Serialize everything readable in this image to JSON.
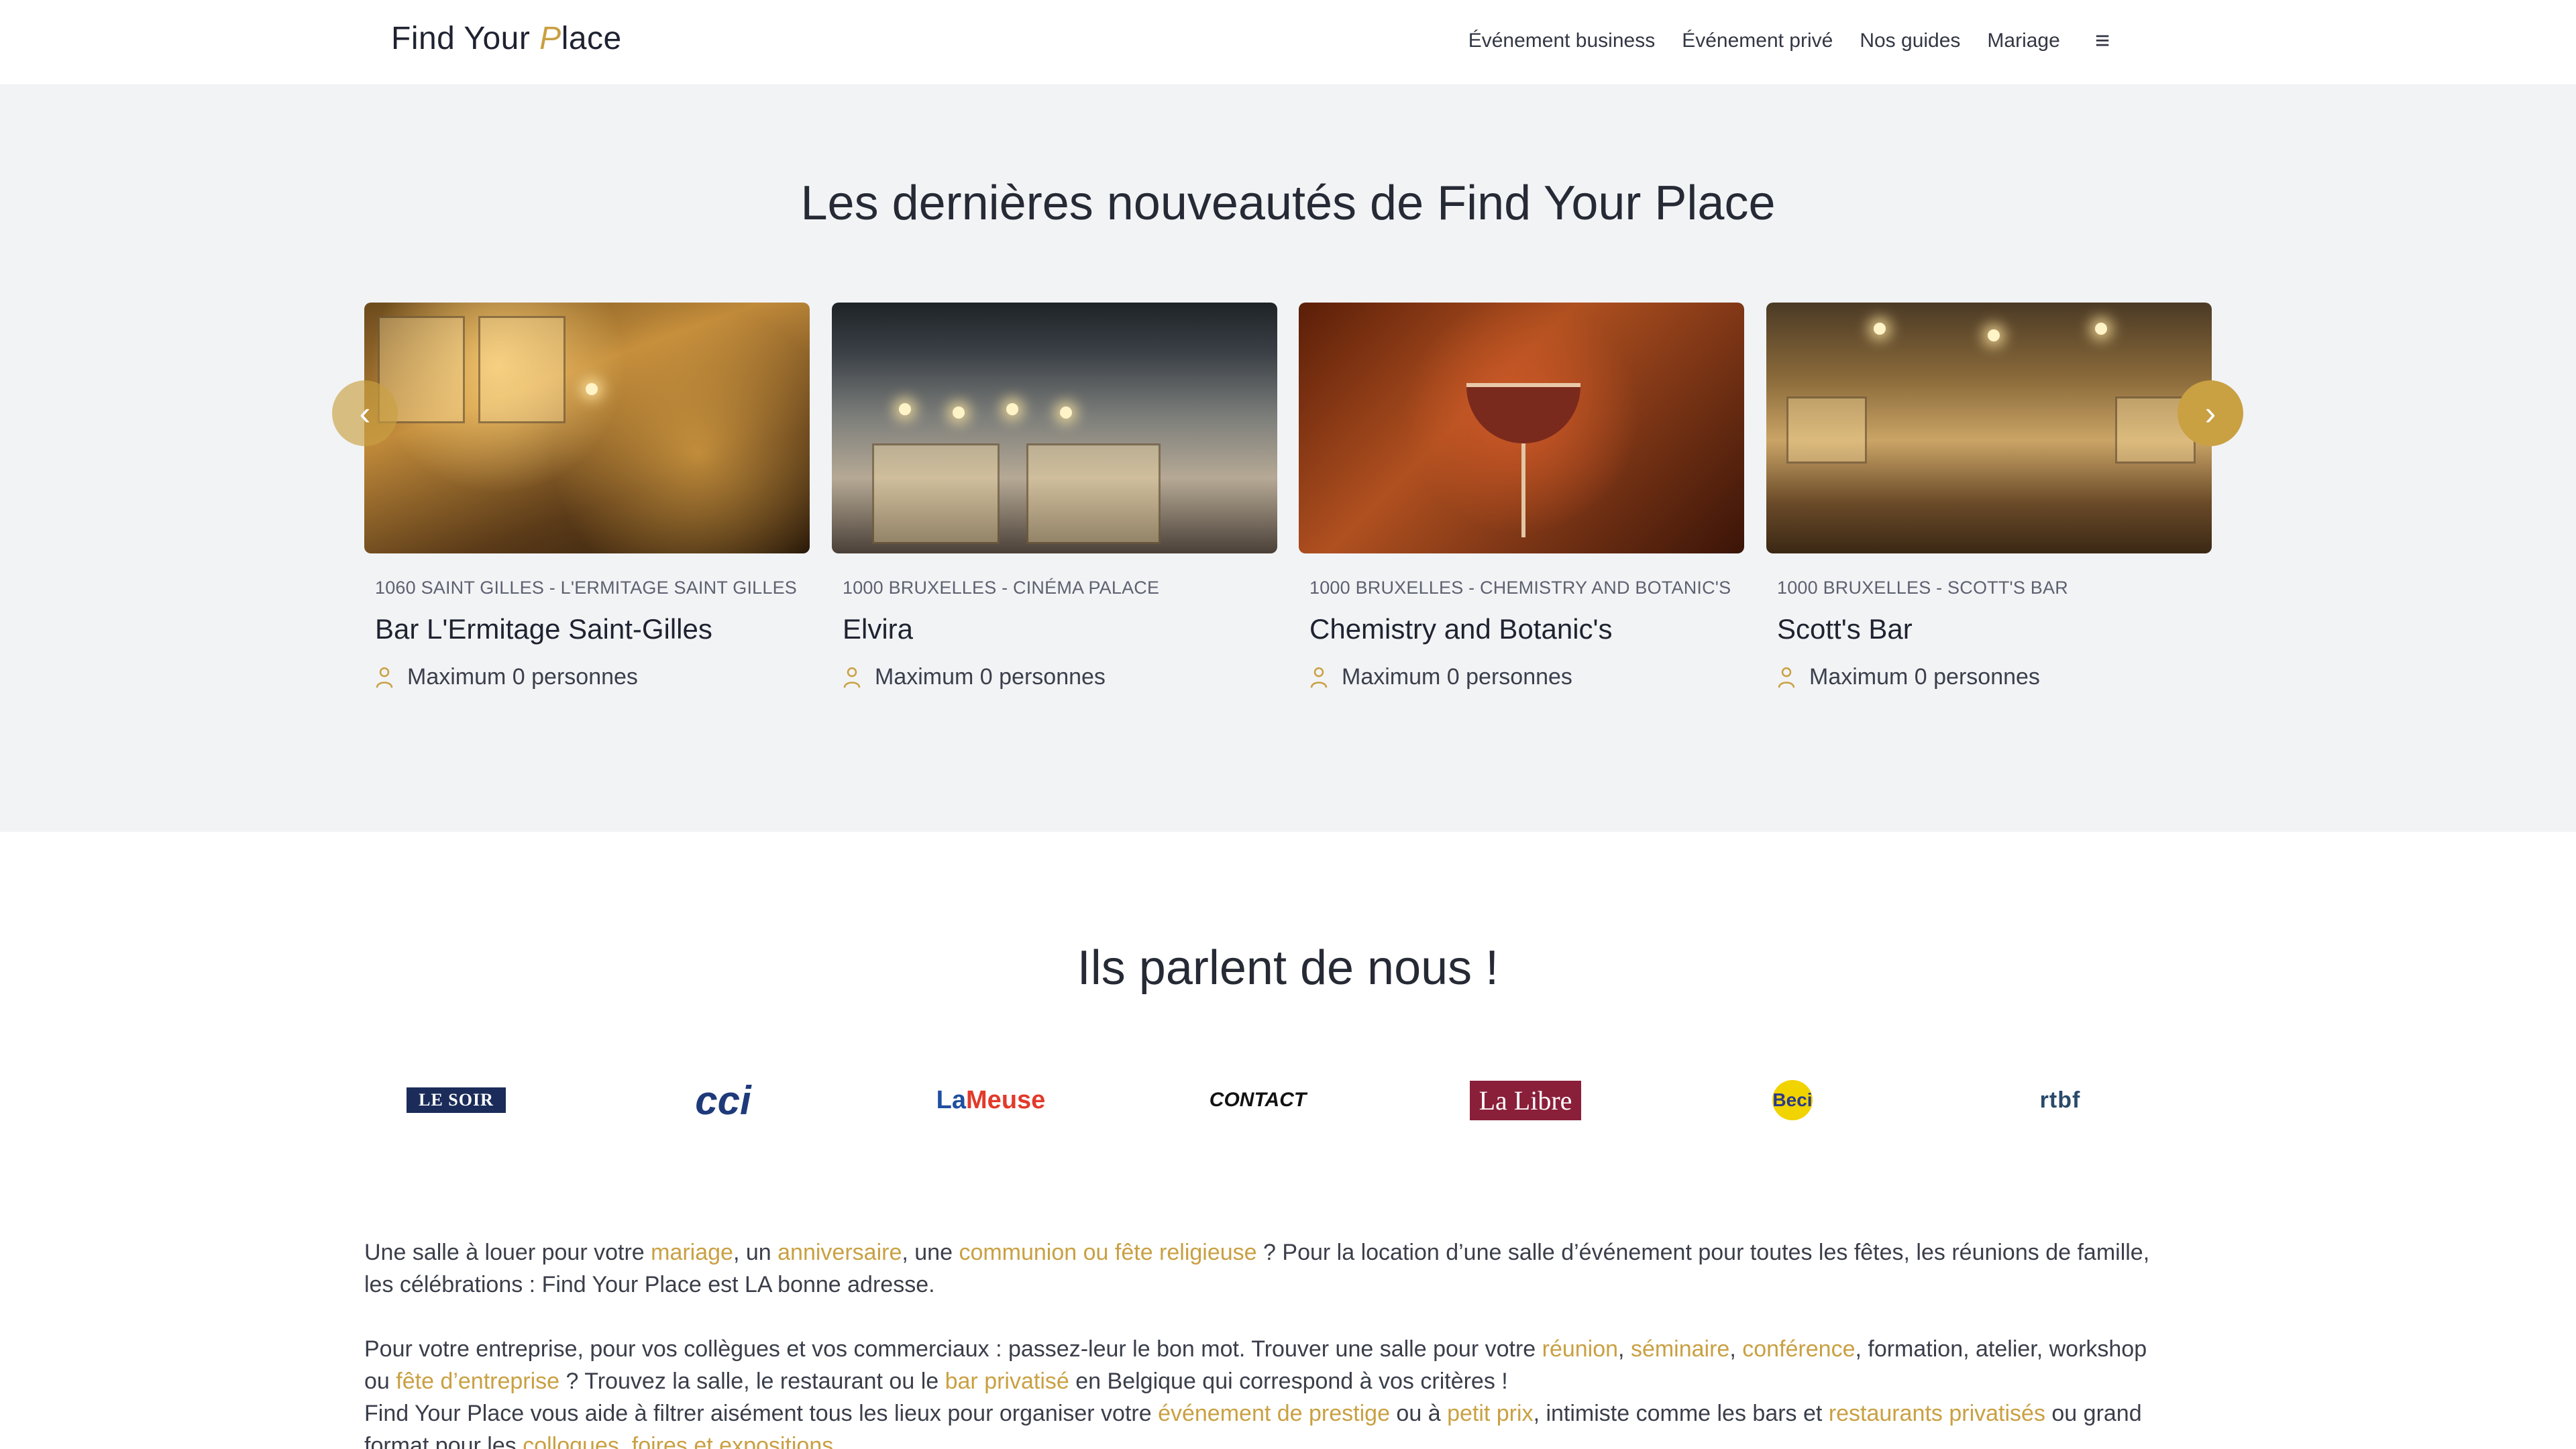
{
  "header": {
    "logo_text_a": "Find Your ",
    "logo_text_accent": "P",
    "logo_text_b": "lace",
    "nav": [
      {
        "label": "Événement business"
      },
      {
        "label": "Événement privé"
      },
      {
        "label": "Nos guides"
      },
      {
        "label": "Mariage"
      }
    ],
    "menu_icon": "≡"
  },
  "latest": {
    "title": "Les dernières nouveautés de Find Your Place",
    "prev_icon": "‹",
    "next_icon": "›",
    "cards": [
      {
        "location": "1060 SAINT GILLES - L'ERMITAGE SAINT GILLES",
        "title": "Bar L'Ermitage Saint-Gilles",
        "capacity": "Maximum 0 personnes"
      },
      {
        "location": "1000 BRUXELLES - CINÉMA PALACE",
        "title": "Elvira",
        "capacity": "Maximum 0 personnes"
      },
      {
        "location": "1000 BRUXELLES - CHEMISTRY AND BOTANIC'S",
        "title": "Chemistry and Botanic's",
        "capacity": "Maximum 0 personnes"
      },
      {
        "location": "1000 BRUXELLES - SCOTT'S BAR",
        "title": "Scott's Bar",
        "capacity": "Maximum 0 personnes"
      }
    ]
  },
  "press": {
    "title": "Ils parlent de nous !",
    "logos": {
      "lesoir": "LE SOIR",
      "cci": "cci",
      "lameuse_a": "La",
      "lameuse_b": "Meuse",
      "radio": "CONTACT",
      "lalibre": "La Libre",
      "beci": "Beci",
      "rtbf": "rtbf"
    }
  },
  "seo": {
    "p1": {
      "t1": "Une salle à louer pour votre ",
      "l1": "mariage",
      "t2": ", un ",
      "l2": "anniversaire",
      "t3": ", une ",
      "l3": "communion ou fête religieuse",
      "t4": " ? Pour la location d’une salle d’événement pour toutes les fêtes, les réunions de famille, les célébrations : Find Your Place est LA bonne adresse."
    },
    "p2": {
      "t1": "Pour votre entreprise, pour vos collègues et vos commerciaux : passez-leur le bon mot. Trouver une salle pour votre ",
      "l1": "réunion",
      "t2": ", ",
      "l2": "séminaire",
      "t3": ", ",
      "l3": "conférence",
      "t4": ", formation, atelier, workshop ou ",
      "l4": "fête d’entreprise",
      "t5": " ? Trouvez la salle, le restaurant ou le ",
      "l5": "bar privatisé",
      "t6": " en Belgique qui correspond à vos critères !"
    },
    "p3": {
      "t1": "Find Your Place vous aide à filtrer aisément tous les lieux pour organiser votre ",
      "l1": "événement de prestige",
      "t2": " ou à ",
      "l2": "petit prix",
      "t3": ", intimiste comme les bars et ",
      "l3": "restaurants privatisés",
      "t4": " ou grand format pour les ",
      "l4": "colloques, foires et expositions",
      "t5": "..."
    }
  }
}
